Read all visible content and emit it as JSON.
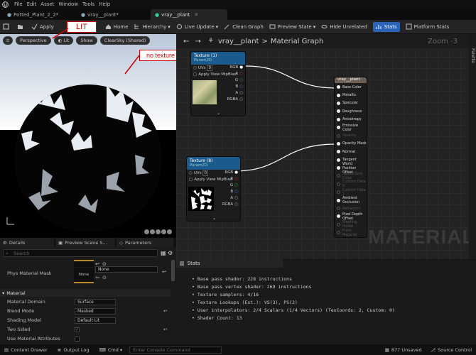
{
  "menu": [
    "File",
    "Edit",
    "Asset",
    "Window",
    "Tools",
    "Help"
  ],
  "tabs": [
    {
      "label": "Potted_Plant_2_2*",
      "active": false
    },
    {
      "label": "vray__plant*",
      "active": false
    },
    {
      "label": "vray__plant",
      "active": true
    }
  ],
  "toolbar": {
    "apply": "Apply",
    "home": "Home",
    "hierarchy": "Hierarchy",
    "live_update": "Live Update",
    "clean_graph": "Clean Graph",
    "preview_state": "Preview State",
    "hide_unrelated": "Hide Unrelated",
    "stats": "Stats",
    "platform_stats": "Platform Stats"
  },
  "viewport": {
    "perspective": "Perspective",
    "lit": "Lit",
    "show": "Show",
    "sky": "ClearSky (Shared)"
  },
  "callouts": {
    "lit": "LIT",
    "no_texture": "no texture"
  },
  "lower_tabs": [
    "Details",
    "Preview Scene S...",
    "Parameters"
  ],
  "details": {
    "search_placeholder": "Search",
    "phys_mask_label": "Phys Material Mask",
    "phys_mask_value": "None",
    "phys_mask_thumb": "None",
    "section": "Material",
    "rows": [
      {
        "label": "Material Domain",
        "value": "Surface"
      },
      {
        "label": "Blend Mode",
        "value": "Masked"
      },
      {
        "label": "Shading Model",
        "value": "Default Lit"
      },
      {
        "label": "Two Sided",
        "value": ""
      },
      {
        "label": "Use Material Attributes",
        "value": ""
      }
    ]
  },
  "graph": {
    "breadcrumb_root": "vray__plant",
    "breadcrumb_sep": ">",
    "breadcrumb_page": "Material Graph",
    "zoom": "Zoom -3",
    "palette": "Palette",
    "watermark": "MATERIAL"
  },
  "tex1": {
    "title": "Texture (1)",
    "sub": "Param2D",
    "uvs": "UVs",
    "uv_num": "0",
    "mip": "Apply View MipBias",
    "outs": [
      "RGB",
      "R",
      "G",
      "B",
      "A",
      "RGBA"
    ]
  },
  "tex2": {
    "title": "Texture (8)",
    "sub": "Param2D",
    "uvs": "UVs",
    "uv_num": "0",
    "mip": "Apply View MipBias",
    "outs": [
      "RGB",
      "R",
      "G",
      "B",
      "A",
      "RGBA"
    ]
  },
  "matnode": {
    "title": "vray__plant",
    "pins": [
      {
        "label": "Base Color",
        "dim": false
      },
      {
        "label": "Metallic",
        "dim": false
      },
      {
        "label": "Specular",
        "dim": false
      },
      {
        "label": "Roughness",
        "dim": false
      },
      {
        "label": "Anisotropy",
        "dim": false
      },
      {
        "label": "Emissive Color",
        "dim": false
      },
      {
        "label": "Opacity",
        "dim": true
      },
      {
        "label": "Opacity Mask",
        "dim": false
      },
      {
        "label": "Normal",
        "dim": false
      },
      {
        "label": "Tangent",
        "dim": false
      },
      {
        "label": "World Position Offset",
        "dim": false
      },
      {
        "label": "Subsurface Color",
        "dim": true
      },
      {
        "label": "Custom Data 0",
        "dim": true
      },
      {
        "label": "Custom Data 1",
        "dim": true
      },
      {
        "label": "Ambient Occlusion",
        "dim": false
      },
      {
        "label": "Refraction",
        "dim": true
      },
      {
        "label": "Pixel Depth Offset",
        "dim": false
      },
      {
        "label": "Shading Model",
        "dim": true
      },
      {
        "label": "Front Material",
        "dim": true
      }
    ]
  },
  "stats": {
    "title": "Stats",
    "lines": [
      "Base pass shader: 228 instructions",
      "Base pass vertex shader: 269 instructions",
      "Texture samplers: 4/16",
      "Texture Lookups (Est.): VS(3), PS(2)",
      "User interpolators: 2/4 Scalars (1/4 Vectors) (TexCoords: 2, Custom: 0)",
      "Shader Count: 13"
    ]
  },
  "statusbar": {
    "content_drawer": "Content Drawer",
    "output_log": "Output Log",
    "cmd": "Cmd",
    "console_placeholder": "Enter Console Command",
    "unsaved": "877 Unsaved",
    "source_control": "Source Control"
  }
}
